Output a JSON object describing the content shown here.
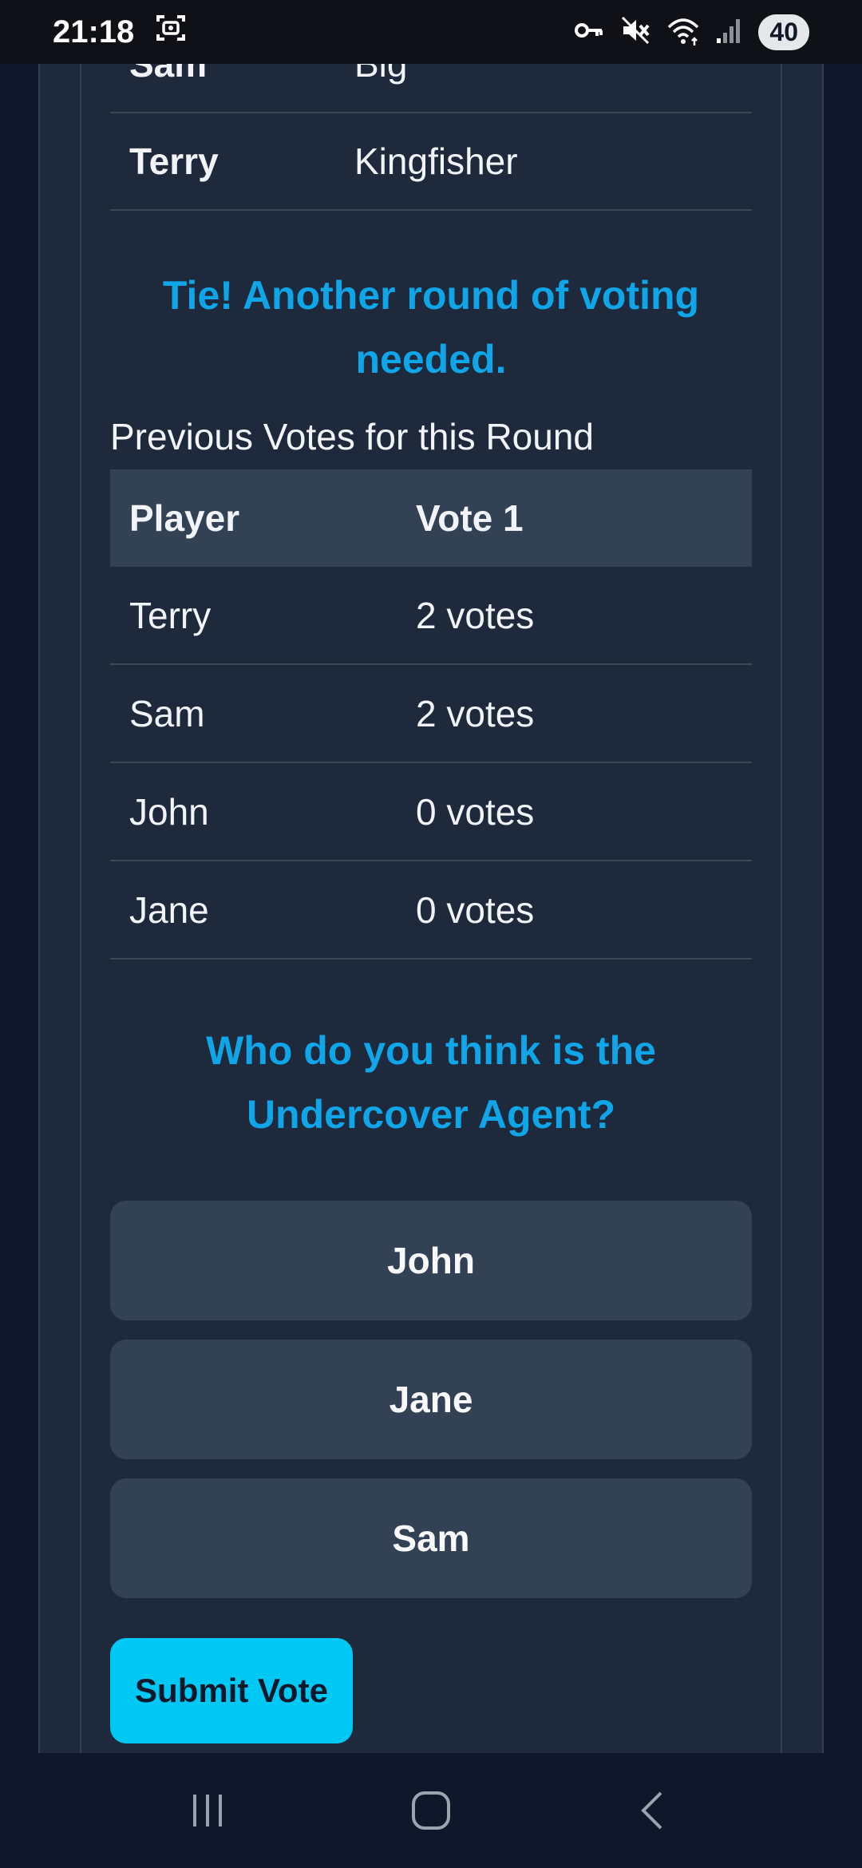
{
  "status_bar": {
    "time": "21:18",
    "battery": "40",
    "icons": [
      "screenshot-icon",
      "vpn-key-icon",
      "mute-icon",
      "wifi-icon",
      "signal-icon"
    ]
  },
  "word_table": {
    "rows": [
      {
        "name": "Sam",
        "word": "Big"
      },
      {
        "name": "Terry",
        "word": "Kingfisher"
      }
    ]
  },
  "tie_message": "Tie! Another round of voting needed.",
  "previous_votes": {
    "title": "Previous Votes for this Round",
    "headers": [
      "Player",
      "Vote 1"
    ],
    "rows": [
      {
        "player": "Terry",
        "votes": "2 votes"
      },
      {
        "player": "Sam",
        "votes": "2 votes"
      },
      {
        "player": "John",
        "votes": "0 votes"
      },
      {
        "player": "Jane",
        "votes": "0 votes"
      }
    ]
  },
  "question": "Who do you think is the Undercover Agent?",
  "options": [
    "John",
    "Jane",
    "Sam"
  ],
  "submit_label": "Submit Vote",
  "colors": {
    "accent": "#0ea5e9",
    "submit": "#00c8f5",
    "panel": "#1e293b",
    "background": "#0f172a",
    "header_row": "#334155"
  },
  "nav_bar": {
    "icons": [
      "recents-icon",
      "home-icon",
      "back-icon"
    ]
  }
}
